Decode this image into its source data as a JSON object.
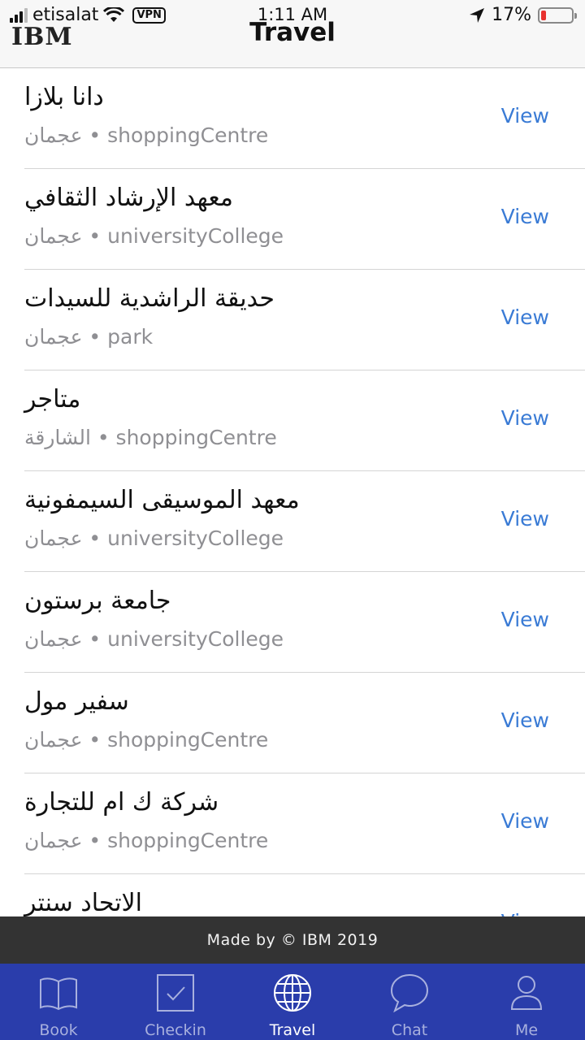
{
  "status": {
    "carrier": "etisalat",
    "vpn": "VPN",
    "time": "1:11 AM",
    "battery": "17%",
    "battery_level": 0.17
  },
  "header": {
    "logo": "IBM",
    "title": "Travel"
  },
  "places": [
    {
      "name": "دانا بلازا",
      "subtitle": "عجمان • shoppingCentre",
      "action": "View"
    },
    {
      "name": "معهد الإرشاد الثقافي",
      "subtitle": "عجمان • universityCollege",
      "action": "View"
    },
    {
      "name": "حديقة الراشدية للسيدات",
      "subtitle": "عجمان • park",
      "action": "View"
    },
    {
      "name": "متاجر",
      "subtitle": "الشارقة • shoppingCentre",
      "action": "View"
    },
    {
      "name": "معهد الموسيقى السيمفونية",
      "subtitle": "عجمان • universityCollege",
      "action": "View"
    },
    {
      "name": "جامعة برستون",
      "subtitle": "عجمان • universityCollege",
      "action": "View"
    },
    {
      "name": "سفير مول",
      "subtitle": "عجمان • shoppingCentre",
      "action": "View"
    },
    {
      "name": "شركة ك ام للتجارة",
      "subtitle": "عجمان • shoppingCentre",
      "action": "View"
    },
    {
      "name": "الاتحاد سنتر",
      "subtitle": "",
      "action": "View"
    }
  ],
  "footer": {
    "text": "Made by © IBM 2019"
  },
  "tabs": [
    {
      "label": "Book",
      "icon": "book-icon"
    },
    {
      "label": "Checkin",
      "icon": "checkin-icon"
    },
    {
      "label": "Travel",
      "icon": "globe-icon",
      "active": true
    },
    {
      "label": "Chat",
      "icon": "chat-icon"
    },
    {
      "label": "Me",
      "icon": "person-icon"
    }
  ],
  "colors": {
    "tabbar": "#2a3dab",
    "link": "#3a7bd5",
    "footer": "#333333",
    "battery_low": "#e8312f"
  }
}
